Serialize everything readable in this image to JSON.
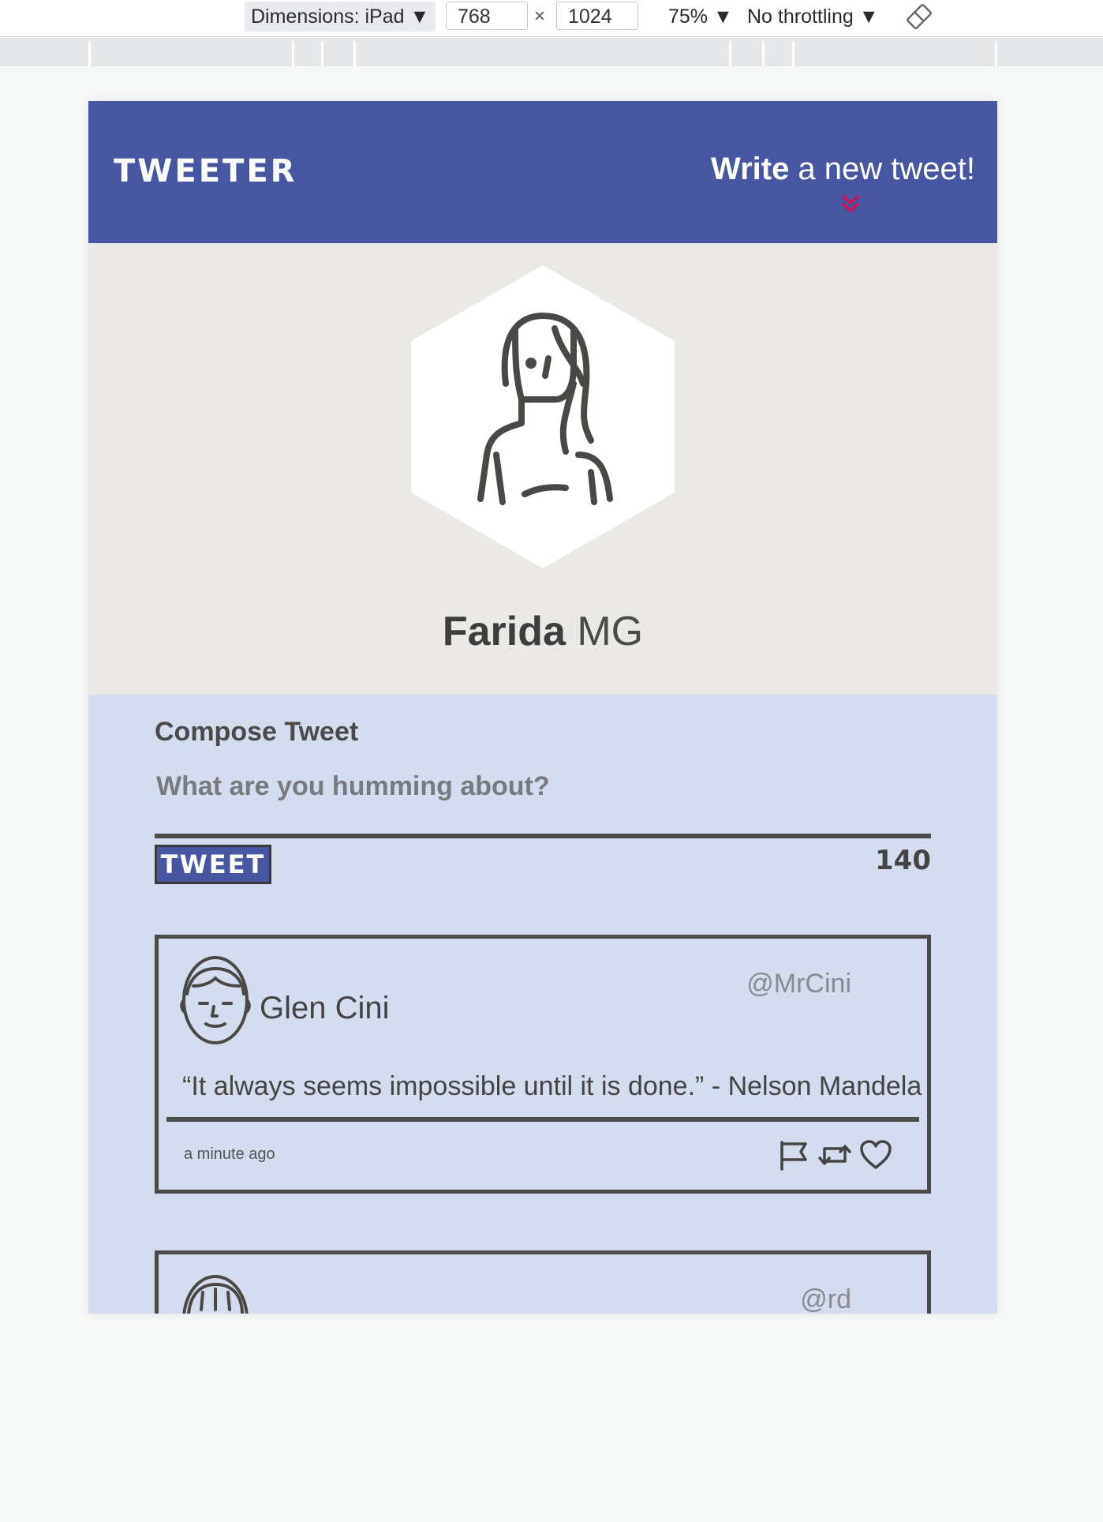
{
  "devtools": {
    "dimensions_label": "Dimensions: iPad ▼",
    "width": "768",
    "times": "×",
    "height": "1024",
    "zoom": "75% ▼",
    "throttling": "No throttling ▼",
    "rotate_icon": "rotate-icon"
  },
  "nav": {
    "logo": "TWEETER",
    "write_bold": "Write",
    "write_rest": " a new tweet!",
    "chevron_icon": "double-chevron-down-icon",
    "accent": "#c2185b",
    "bg": "#4656a0"
  },
  "profile": {
    "first_name": "Farida",
    "last_name": " MG",
    "avatar_icon": "woman-avatar-icon"
  },
  "compose": {
    "title": "Compose Tweet",
    "placeholder": "What are you humming about?",
    "button": "TWEET",
    "counter": "140"
  },
  "tweets": [
    {
      "name": "Glen Cini",
      "handle": "@MrCini",
      "text": "“It always seems impossible until it is done.” - Nelson Mandela",
      "time": "a minute ago",
      "avatar_icon": "man-avatar-icon",
      "actions": [
        "flag-icon",
        "retweet-icon",
        "heart-icon"
      ]
    },
    {
      "name": "",
      "handle": "@rd",
      "avatar_icon": "user-avatar-icon"
    }
  ]
}
